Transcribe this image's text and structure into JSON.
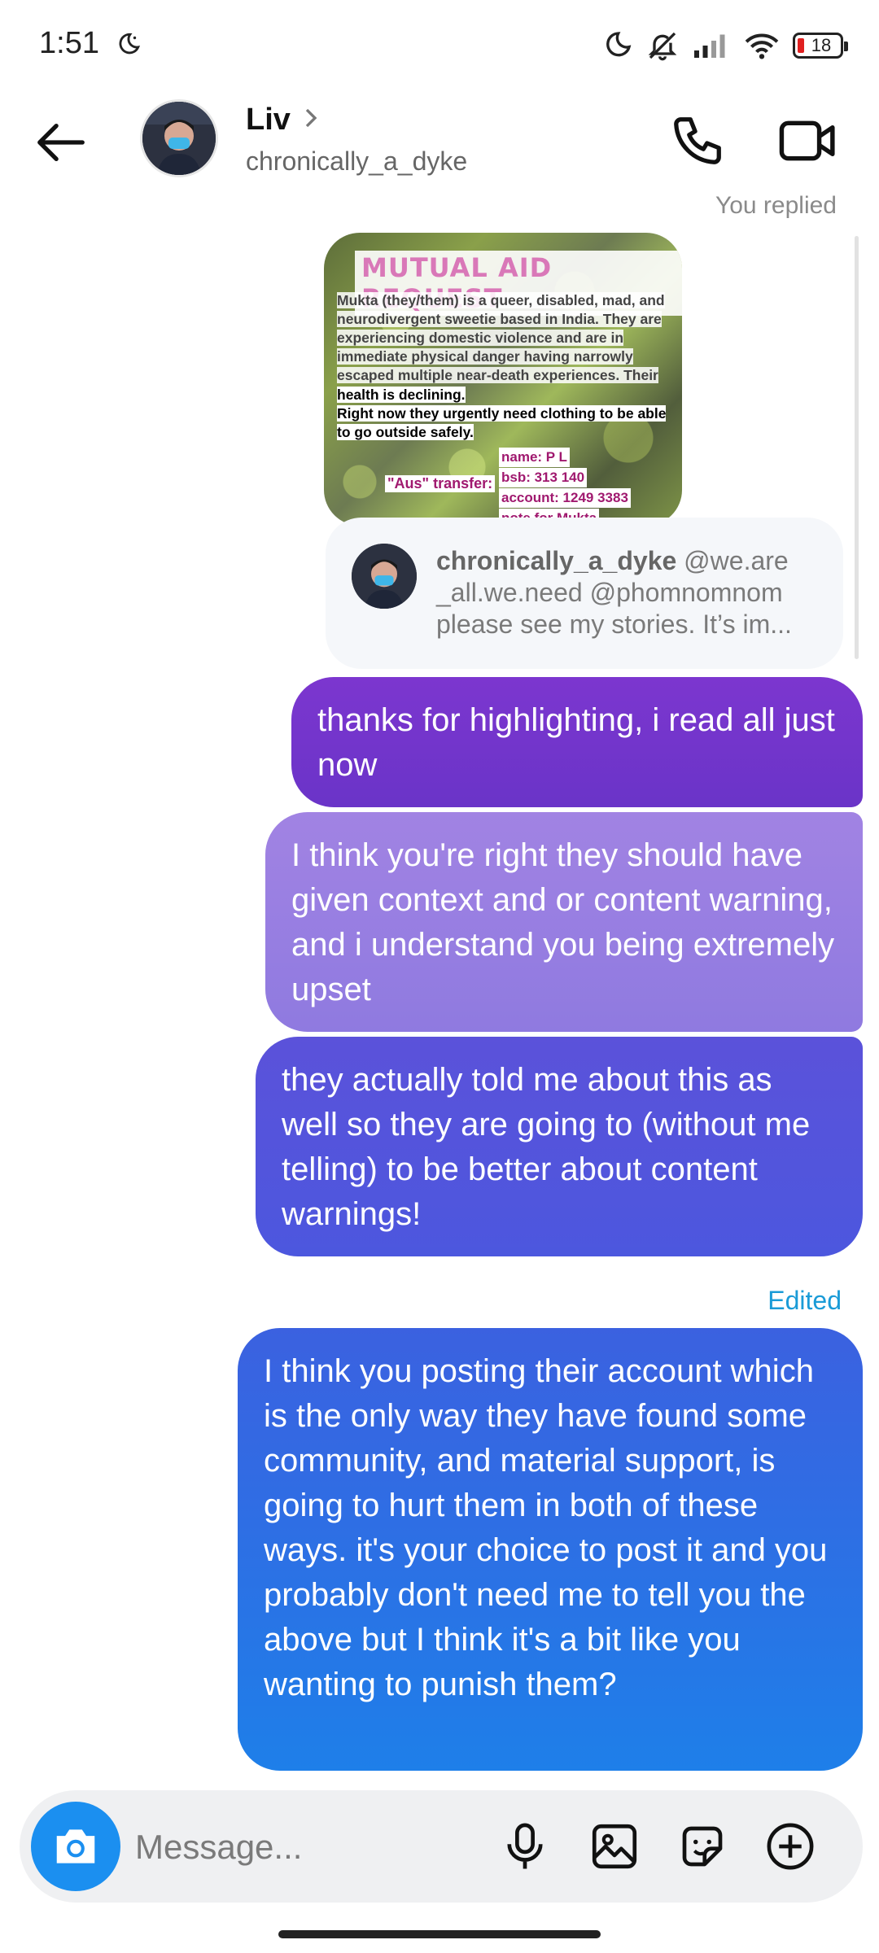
{
  "status_bar": {
    "time": "1:51",
    "battery": "18"
  },
  "header": {
    "name": "Liv",
    "username": "chronically_a_dyke"
  },
  "reply_notice": "You replied",
  "story": {
    "title": "MUTUAL AID REQUEST",
    "lines_grey": [
      "Mukta (they/them) is a queer, disabled, mad, and",
      "neurodivergent sweetie based in India. They are",
      "experiencing domestic violence and are in",
      "immediate physical danger having narrowly",
      "escaped multiple near-death experiences. Their"
    ],
    "lines_black": [
      "health is declining.",
      "Right now they urgently need clothing to be able",
      "to go outside safely."
    ],
    "transfer_label": "\"Aus\" transfer:",
    "bank_lines": [
      "name: P L",
      "bsb: 313 140",
      "account: 1249 3383",
      "note for Mukta"
    ]
  },
  "replied_story": {
    "author": "chronically_a_dyke",
    "text": " @we.are _all.we.need @phomnomnom please see my stories. It’s im..."
  },
  "messages": [
    {
      "text": "thanks for highlighting, i read all just now"
    },
    {
      "text": "I think you're right they should have given context and or content warning, and i understand you being extremely upset"
    },
    {
      "text": "they actually told me about this as well so they are going to (without me telling) to be better about content warnings!"
    },
    {
      "text": "I think you posting their account which is the only way they have found some community, and material support, is going to hurt them in both of these ways. it's your choice to post it and you probably don't need me to tell you the above but I think it's a bit like you wanting to punish them?"
    }
  ],
  "edited_label": "Edited",
  "composer": {
    "placeholder": "Message..."
  },
  "icons": {
    "status": [
      "moon-icon",
      "dnd-icon",
      "mute-icon",
      "signal-icon",
      "wifi-icon",
      "battery-icon"
    ],
    "header": [
      "back-arrow-icon",
      "chevron-right-icon",
      "phone-icon",
      "video-camera-icon"
    ],
    "composer": [
      "camera-icon",
      "microphone-icon",
      "image-icon",
      "sticker-icon",
      "plus-icon"
    ]
  },
  "colors": {
    "accent_blue": "#1b8ff0",
    "edited": "#1a9bd7"
  }
}
